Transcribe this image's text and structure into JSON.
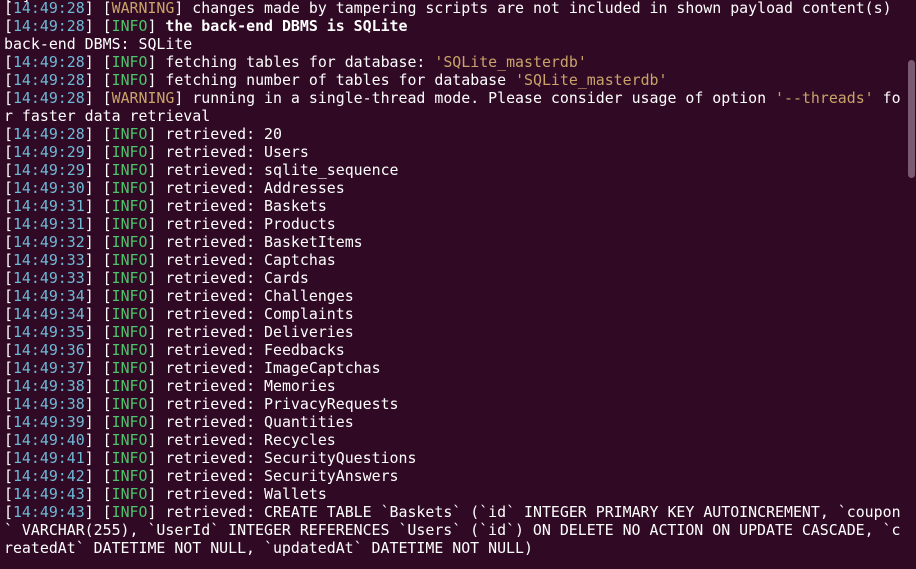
{
  "top_partial": "[*]",
  "lines": [
    {
      "ts": "14:49:28",
      "level": "WARNING",
      "msg": " changes made by tampering scripts are not included in shown payload content(s)"
    },
    {
      "ts": "14:49:28",
      "level": "INFO",
      "msg": " the back-end DBMS is SQLite",
      "bold": true
    },
    {
      "plain": "back-end DBMS: SQLite"
    },
    {
      "ts": "14:49:28",
      "level": "INFO",
      "msg": " fetching tables for database: ",
      "quoted": "'SQLite_masterdb'"
    },
    {
      "ts": "14:49:28",
      "level": "INFO",
      "msg": " fetching number of tables for database ",
      "quoted": "'SQLite_masterdb'"
    },
    {
      "ts": "14:49:28",
      "level": "WARNING",
      "msg": " running in a single-thread mode. Please consider usage of option ",
      "quoted": "'--threads'",
      "tail": " fo"
    },
    {
      "plain": "r faster data retrieval"
    },
    {
      "ts": "14:49:28",
      "level": "INFO",
      "msg": " retrieved: 20"
    },
    {
      "ts": "14:49:29",
      "level": "INFO",
      "msg": " retrieved: Users"
    },
    {
      "ts": "14:49:29",
      "level": "INFO",
      "msg": " retrieved: sqlite_sequence"
    },
    {
      "ts": "14:49:30",
      "level": "INFO",
      "msg": " retrieved: Addresses"
    },
    {
      "ts": "14:49:31",
      "level": "INFO",
      "msg": " retrieved: Baskets"
    },
    {
      "ts": "14:49:31",
      "level": "INFO",
      "msg": " retrieved: Products"
    },
    {
      "ts": "14:49:32",
      "level": "INFO",
      "msg": " retrieved: BasketItems"
    },
    {
      "ts": "14:49:33",
      "level": "INFO",
      "msg": " retrieved: Captchas"
    },
    {
      "ts": "14:49:33",
      "level": "INFO",
      "msg": " retrieved: Cards"
    },
    {
      "ts": "14:49:34",
      "level": "INFO",
      "msg": " retrieved: Challenges"
    },
    {
      "ts": "14:49:34",
      "level": "INFO",
      "msg": " retrieved: Complaints"
    },
    {
      "ts": "14:49:35",
      "level": "INFO",
      "msg": " retrieved: Deliveries"
    },
    {
      "ts": "14:49:36",
      "level": "INFO",
      "msg": " retrieved: Feedbacks"
    },
    {
      "ts": "14:49:37",
      "level": "INFO",
      "msg": " retrieved: ImageCaptchas"
    },
    {
      "ts": "14:49:38",
      "level": "INFO",
      "msg": " retrieved: Memories"
    },
    {
      "ts": "14:49:38",
      "level": "INFO",
      "msg": " retrieved: PrivacyRequests"
    },
    {
      "ts": "14:49:39",
      "level": "INFO",
      "msg": " retrieved: Quantities"
    },
    {
      "ts": "14:49:40",
      "level": "INFO",
      "msg": " retrieved: Recycles"
    },
    {
      "ts": "14:49:41",
      "level": "INFO",
      "msg": " retrieved: SecurityQuestions"
    },
    {
      "ts": "14:49:42",
      "level": "INFO",
      "msg": " retrieved: SecurityAnswers"
    },
    {
      "ts": "14:49:43",
      "level": "INFO",
      "msg": " retrieved: Wallets"
    },
    {
      "ts": "14:49:43",
      "level": "INFO",
      "msg": " retrieved: CREATE TABLE `Baskets` (`id` INTEGER PRIMARY KEY AUTOINCREMENT, `coupon"
    },
    {
      "plain": "` VARCHAR(255), `UserId` INTEGER REFERENCES `Users` (`id`) ON DELETE NO ACTION ON UPDATE CASCADE, `c"
    },
    {
      "plain": "reatedAt` DATETIME NOT NULL, `updatedAt` DATETIME NOT NULL)"
    }
  ],
  "colors": {
    "background": "#300a24",
    "timestamp": "#6fb8d6",
    "info": "#4cc46a",
    "warning": "#c9a36a",
    "text": "#ffffff"
  }
}
